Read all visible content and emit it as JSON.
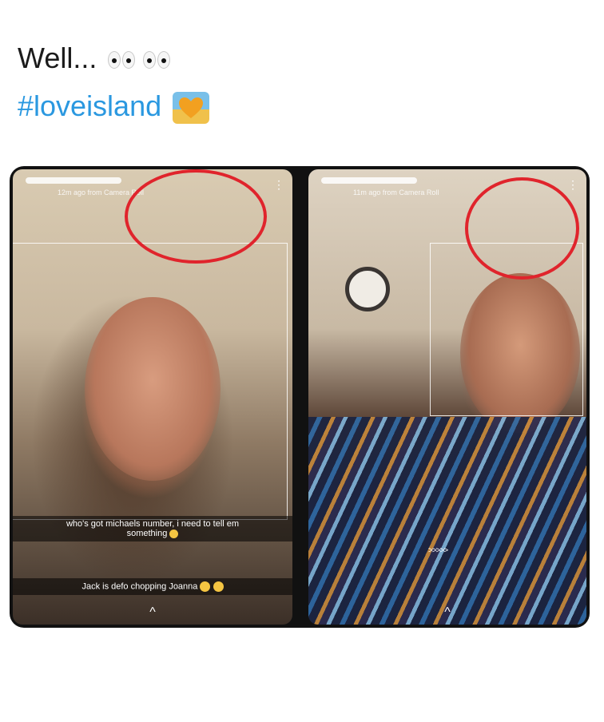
{
  "post": {
    "line1": "Well...",
    "hashtag": "#loveisland"
  },
  "left_panel": {
    "story_time": "12m ago from Camera Roll",
    "caption1_line1": "who's got michaels number, i need to tell em",
    "caption1_line2": "something",
    "caption2": "Jack is defo chopping Joanna",
    "swipe": "^",
    "dots": "⋮"
  },
  "right_panel": {
    "story_time": "11m ago from Camera Roll",
    "arrows": ">>>>>",
    "swipe": "^",
    "dots": "⋮"
  },
  "colors": {
    "hashtag": "#2a98e0",
    "highlight_circle": "#e0242c"
  },
  "icons": {
    "eyes": "eyes-emoji",
    "heart": "heart-emoji",
    "face": "grimace-emoji"
  }
}
